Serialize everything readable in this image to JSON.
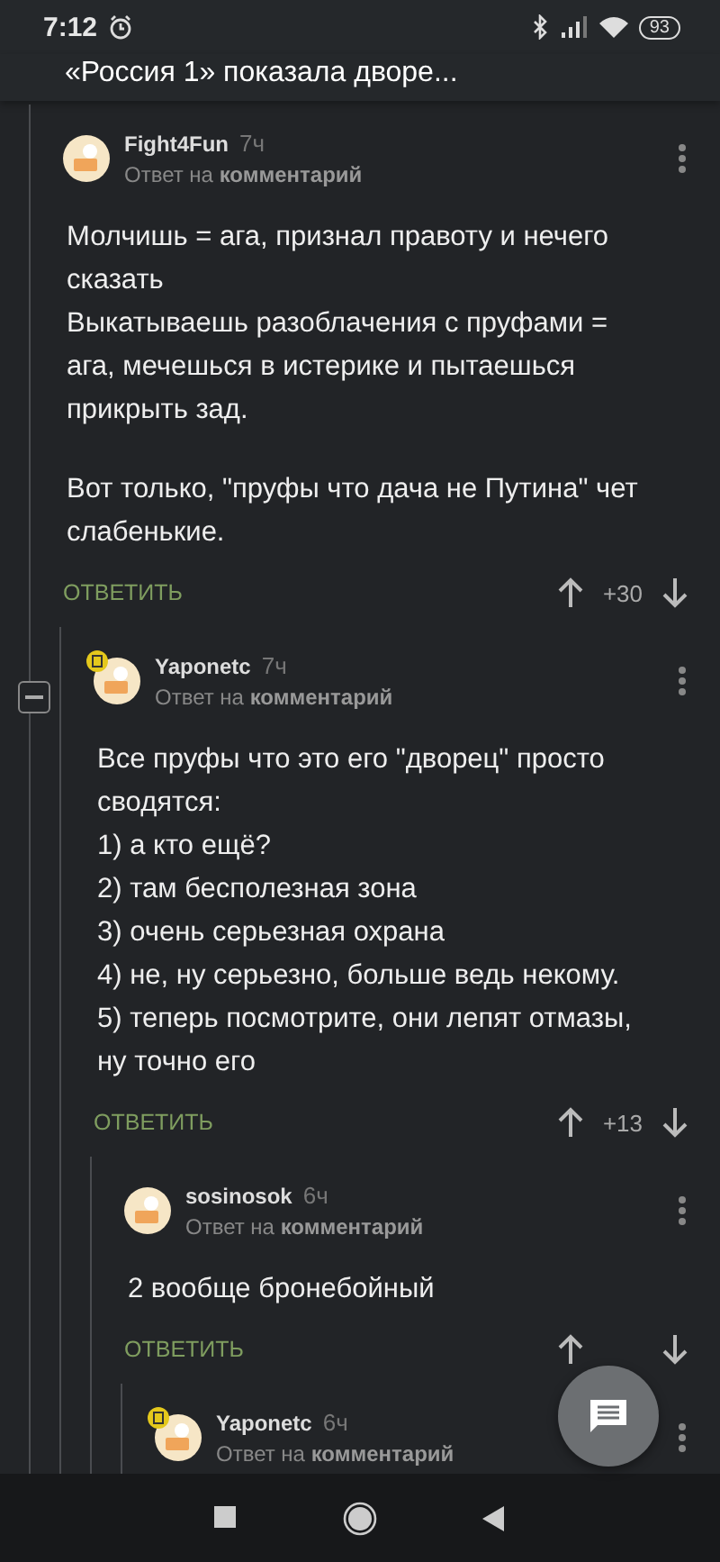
{
  "status_bar": {
    "time": "7:12",
    "battery": "93"
  },
  "header": {
    "title": "«Россия 1» показала дворе..."
  },
  "comments": [
    {
      "author": "Fight4Fun",
      "time": "7ч",
      "reply_prefix": "Ответ на",
      "reply_target": "комментарий",
      "badge": false,
      "collapsible": false,
      "paragraphs": [
        [
          "Молчишь = ага, признал правоту и нечего сказать",
          "Выкатываешь разоблачения с пруфами = ага, мечешься в истерике и пытаешься прикрыть зад."
        ],
        [
          "Вот только, \"пруфы что дача не Путина\" чет слабенькие."
        ]
      ],
      "reply_label": "ОТВЕТИТЬ",
      "rating": "+30",
      "children": [
        {
          "author": "Yaponetc",
          "time": "7ч",
          "reply_prefix": "Ответ на",
          "reply_target": "комментарий",
          "badge": true,
          "collapsible": true,
          "paragraphs": [
            [
              "Все пруфы что это его \"дворец\" просто сводятся:",
              "1) а кто ещё?",
              "2) там бесполезная зона",
              "3) очень серьезная охрана",
              "4) не, ну серьезно, больше ведь некому.",
              "5) теперь посмотрите, они лепят отмазы, ну точно его"
            ]
          ],
          "reply_label": "ОТВЕТИТЬ",
          "rating": "+13",
          "children": [
            {
              "author": "sosinosok",
              "time": "6ч",
              "reply_prefix": "Ответ на",
              "reply_target": "комментарий",
              "badge": false,
              "collapsible": false,
              "paragraphs": [
                [
                  "2 вообще бронебойный"
                ]
              ],
              "reply_label": "ОТВЕТИТЬ",
              "children": [
                {
                  "author": "Yaponetc",
                  "time": "6ч",
                  "reply_prefix": "Ответ на",
                  "reply_target": "комментарий",
                  "badge": true,
                  "collapsible": false
                }
              ]
            }
          ]
        }
      ]
    }
  ]
}
